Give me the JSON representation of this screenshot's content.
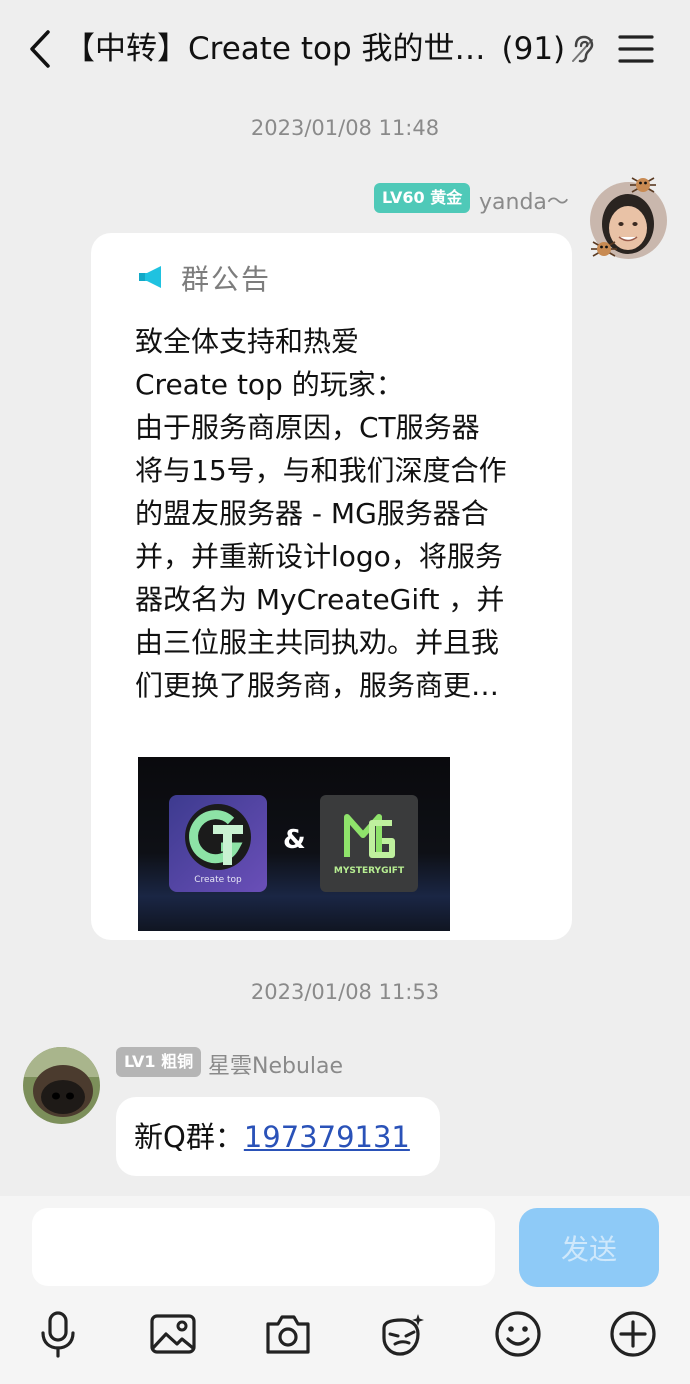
{
  "header": {
    "title": "【中转】Create top 我的世…",
    "member_count": "(91)"
  },
  "messages": [
    {
      "timestamp": "2023/01/08 11:48",
      "sender": "yanda～",
      "badge": "LV60 黄金",
      "announcement": {
        "title": "群公告",
        "body": "致全体支持和热爱\nCreate top 的玩家：\n由于服务商原因，CT服务器\n将与15号，与和我们深度合作\n的盟友服务器 - MG服务器合\n并，并重新设计logo，将服务\n器改名为 MyCreateGift ，并\n由三位服主共同执劝。并且我\n们更换了服务商，服务商更…",
        "image": {
          "logo_left_text": "Create top",
          "separator": "&",
          "logo_right_text": "MYSTERYGIFT"
        }
      }
    },
    {
      "timestamp": "2023/01/08 11:53",
      "sender": "星雲Nebulae",
      "badge": "LV1 粗铜",
      "text_prefix": "新Q群：",
      "link": "197379131"
    }
  ],
  "input": {
    "value": "",
    "send_label": "发送"
  },
  "toolbar": [
    "mic-icon",
    "image-icon",
    "camera-icon",
    "sticker-icon",
    "emoji-icon",
    "plus-icon"
  ],
  "colors": {
    "background": "#eeeeee",
    "badge_gold": "#4fc9b8",
    "badge_bronze": "#b5b5b5",
    "link": "#2a52b8",
    "send_button": "#8ecaf7"
  }
}
